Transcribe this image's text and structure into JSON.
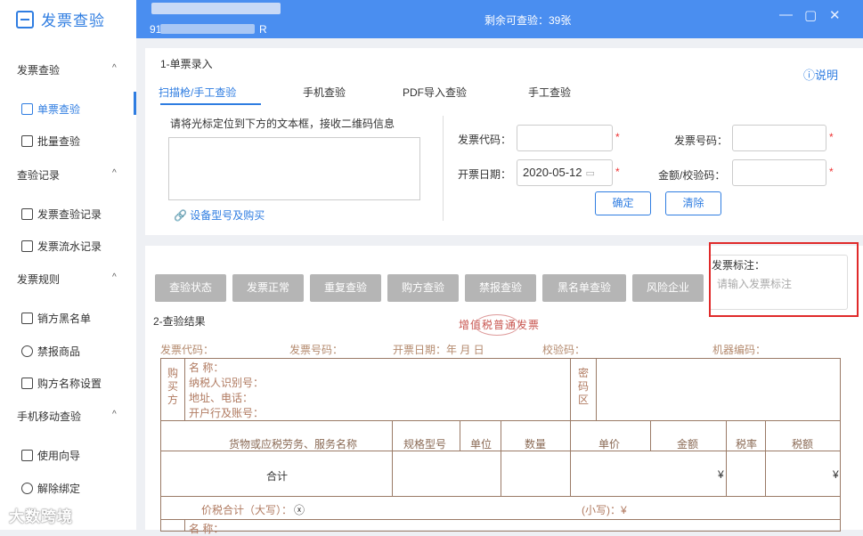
{
  "app": {
    "name": "发票查验"
  },
  "header": {
    "tax_id": "911",
    "tax_id_suffix": "R",
    "remaining": "剩余可查验：39张"
  },
  "window": {
    "minimize": "—",
    "maximize": "▢",
    "close": "✕"
  },
  "sidebar": {
    "groups": [
      {
        "label": "发票查验",
        "items": [
          "单票查验",
          "批量查验"
        ]
      },
      {
        "label": "查验记录",
        "items": [
          "发票查验记录",
          "发票流水记录"
        ]
      },
      {
        "label": "发票规则",
        "items": [
          "销方黑名单",
          "禁报商品",
          "购方名称设置"
        ]
      },
      {
        "label": "手机移动查验",
        "items": [
          "使用向导",
          "解除绑定"
        ]
      }
    ],
    "caret": "^"
  },
  "watermark": "大数跨境",
  "entry": {
    "title": "1-单票录入",
    "help": "ⓘ说明",
    "tabs": [
      "扫描枪/手工查验",
      "手机查验",
      "PDF导入查验",
      "手工查验"
    ],
    "instruction": "请将光标定位到下方的文本框，接收二维码信息",
    "device_link": "设备型号及购买",
    "invoice_code_label": "发票代码：",
    "invoice_number_label": "发票号码：",
    "date_label": "开票日期：",
    "date_value": "2020-05-12",
    "amount_label": "金额/校验码：",
    "required": "*",
    "confirm": "确定",
    "clear": "清除"
  },
  "result": {
    "buttons": [
      "查验状态",
      "发票正常",
      "重复查验",
      "购方查验",
      "禁报查验",
      "黑名单查验",
      "风险企业"
    ],
    "title": "2-查验结果",
    "stamp": "增值税普通发票",
    "note_label": "发票标注：",
    "note_placeholder": "请输入发票标注",
    "header_fields": [
      "发票代码：",
      "发票号码：",
      "开票日期：年 月 日",
      "校验码：",
      "机器编码："
    ],
    "buyer_side": "购买方",
    "buyer_fields": [
      "名  称：",
      "纳税人识别号：",
      "地址、电话：",
      "开户行及账号："
    ],
    "cipher": "密码区",
    "columns": [
      "货物或应税劳务、服务名称",
      "规格型号",
      "单位",
      "数量",
      "单价",
      "金额",
      "税率",
      "税额"
    ],
    "total_label": "合计",
    "yen": "¥",
    "total_caps": "价税合计（大写）：",
    "cross": "ⓧ",
    "total_small": "(小写)：¥",
    "seller_name": "名  称："
  }
}
